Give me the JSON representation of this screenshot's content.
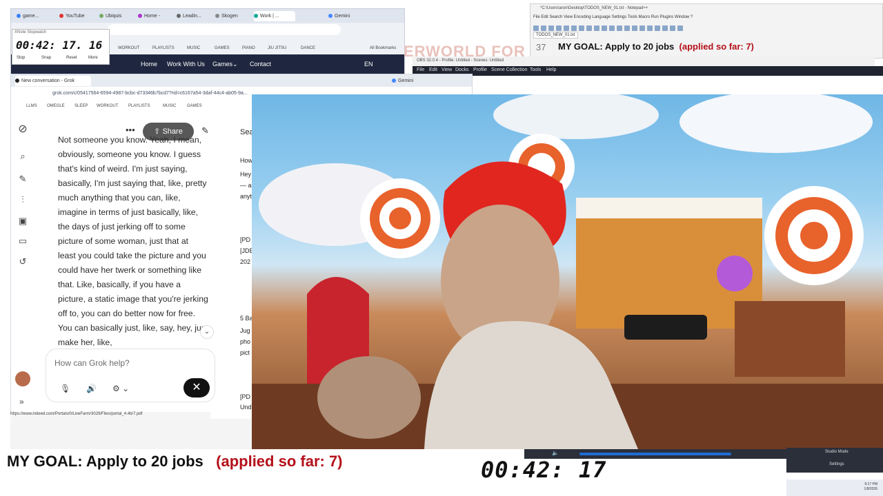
{
  "browser_back": {
    "tabs": [
      "game...",
      "YouTube",
      "Ubiquis",
      "Home -",
      "Leadin...",
      "Skogen",
      "Work | ...",
      "Gemini"
    ],
    "bookmarks": [
      "WORKOUT",
      "PLAYLISTS",
      "MUSIC",
      "GAMES",
      "PIANO",
      "JIU JITSU",
      "DANCE",
      "All Bookmarks"
    ],
    "nav": [
      "Home",
      "Work With Us",
      "Games",
      "Contact",
      "EN"
    ]
  },
  "stopwatch": {
    "title": "XNote Stopwatch",
    "time": "00:42: 17. 16",
    "buttons": [
      "Stop",
      "Snap",
      "Reset",
      "More"
    ]
  },
  "notepad": {
    "title": "*C:\\Users\\aron\\Desktop\\TODOS_NEW_01.txt - Notepad++",
    "menu": "File  Edit  Search  View  Encoding  Language  Settings  Tools  Macro  Run  Plugins  Window  ?",
    "file_tab": "TODOS_NEW_01.txt",
    "line_no": "37",
    "goal_text": "MY GOAL:  Apply to 20 jobs",
    "goal_progress": "(applied so far: 7)"
  },
  "banner_text": "ERWORLD FOR",
  "obs": {
    "title": "OBS 32.0.4 - Profile: Untitled - Scenes: Untitled",
    "menu": [
      "File",
      "Edit",
      "View",
      "Docks",
      "Profile",
      "Scene Collection",
      "Tools",
      "Help"
    ],
    "studio_mode": "Studio Mode",
    "settings": "Settings"
  },
  "grok": {
    "tabs": [
      "New conversation - Grok",
      "Gemini"
    ],
    "url": "grok.com/c/05417564-6594-4987-bcbc-d73346b7bcd7?rid=c6167a54-3daf-44c4-ab05-9a...",
    "bookmarks": [
      "LLMS",
      "OMEGLE",
      "SLEEP",
      "WORKOUT",
      "PLAYLISTS",
      "MUSIC",
      "GAMES",
      "PIANO",
      "JIU JITSU",
      "DANCE"
    ],
    "share": "Share",
    "message": "Not someone you know. Yeah, I mean, obviously, someone you know. I guess that's kind of weird. I'm just saying, basically, I'm just saying that, like, pretty much anything that you can, like, imagine in terms of just basically, like, the days of just jerking off to some picture of some woman, just that at least you could take the picture and you could have her twerk or something like that. Like, basically, if you have a picture, a static image that you're jerking off to, you can do better now for free. You can basically just, like, say, hey, just make her, like,",
    "input_placeholder": "How can Grok help?",
    "status_url": "https://www.indeed.com/Portals/0/LiveFarm/3029/Files/portal_4.4b/7.pdf",
    "search_fragments": [
      "Sea",
      "How",
      "Hey",
      "— ar",
      "anyt",
      "[PD",
      "[JDE",
      "202",
      "5 Ba",
      "Jug",
      "pho",
      "pict",
      "[PD",
      "Und"
    ]
  },
  "overlay": {
    "goal_text": "MY GOAL:  Apply to 20 jobs",
    "goal_progress": "(applied so far: 7)",
    "timer": "00:42: 17"
  },
  "taskbar": {
    "time": "9:17 PM",
    "date": "1/8/2026"
  },
  "colors": {
    "accent_red": "#b4101a",
    "grok_dark": "#111111"
  }
}
